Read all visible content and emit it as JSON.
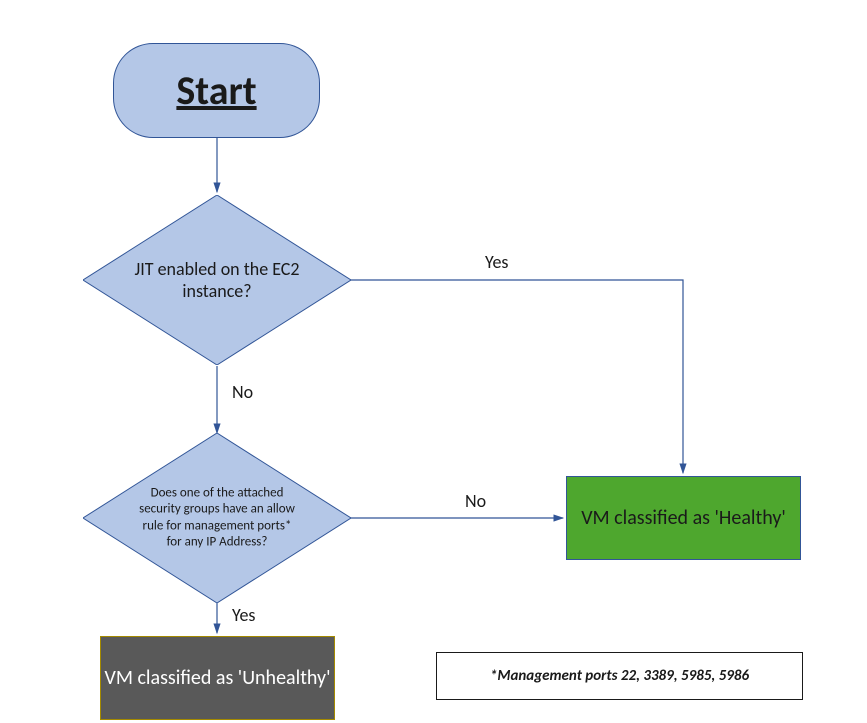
{
  "nodes": {
    "start": {
      "label": "Start"
    },
    "decision1": {
      "label": "JIT enabled on the EC2 instance?"
    },
    "decision2": {
      "label": "Does one of the attached security groups have an allow rule for management ports* for any IP Address?"
    },
    "healthy": {
      "label": "VM classified as 'Healthy'"
    },
    "unhealthy": {
      "label": "VM classified as 'Unhealthy'"
    }
  },
  "edges": {
    "d1_yes": "Yes",
    "d1_no": "No",
    "d2_no": "No",
    "d2_yes": "Yes"
  },
  "footnote": "*Management ports 22, 3389, 5985, 5986",
  "colors": {
    "shape_fill": "#b4c7e7",
    "shape_border": "#315597",
    "healthy_fill": "#4ea72e",
    "unhealthy_fill": "#595959",
    "connector": "#315597"
  }
}
